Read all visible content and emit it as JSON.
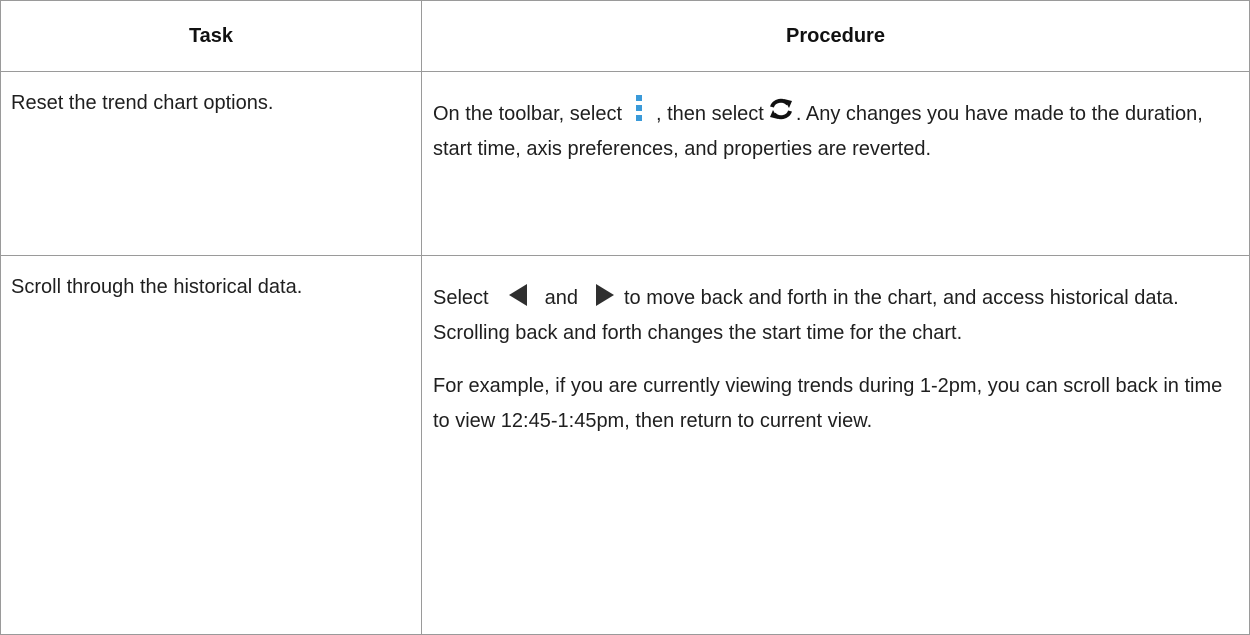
{
  "table": {
    "headers": {
      "task": "Task",
      "procedure": "Procedure"
    },
    "rows": [
      {
        "task": "Reset the trend chart options.",
        "procedure": {
          "p1_part1": "On the toolbar, select",
          "p1_part2": ", then select",
          "p1_part3": ". Any changes you have made to the duration, start time, axis preferences, and properties are reverted.",
          "icons": [
            "more-vertical-icon",
            "refresh-icon"
          ]
        }
      },
      {
        "task": "Scroll through the historical data.",
        "procedure": {
          "p1_part1": "Select",
          "p1_part2": "and",
          "p1_part3": "to move back and forth in the chart, and ac­cess historical data. Scrolling back and forth changes the start time for the chart.",
          "p2": "For example, if you are currently viewing trends during 1-2pm, you can scroll back in time to view 12:45-1:45pm, then return to current view.",
          "icons": [
            "arrow-left-icon",
            "arrow-right-icon"
          ]
        }
      }
    ]
  },
  "colors": {
    "icon_blue": "#3a9ad9",
    "icon_dark": "#111111",
    "icon_arrow": "#2f2f2f",
    "border": "#9a9a9a"
  }
}
